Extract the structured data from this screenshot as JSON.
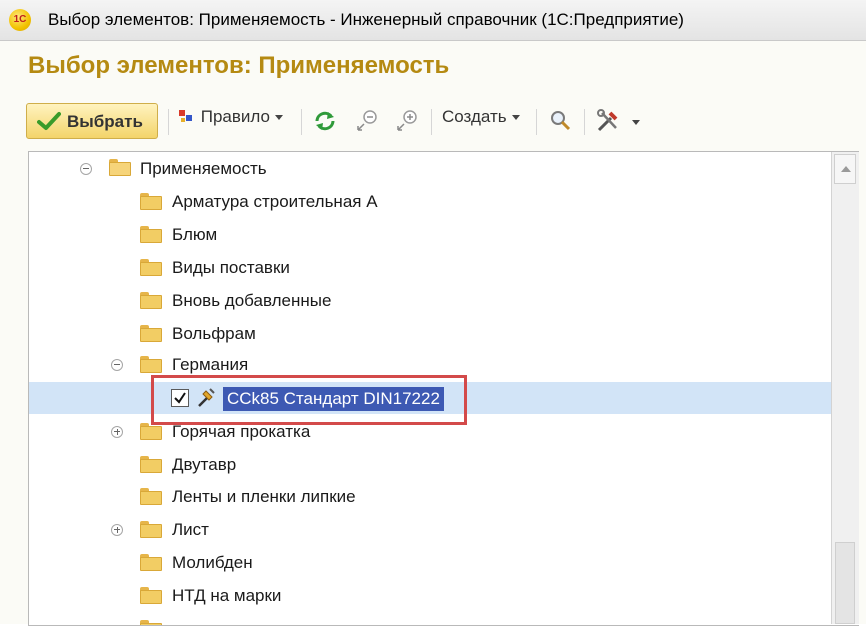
{
  "window": {
    "title": "Выбор элементов: Применяемость - Инженерный справочник  (1С:Предприятие)",
    "logo_text": "1С"
  },
  "form": {
    "title": "Выбор элементов: Применяемость"
  },
  "toolbar": {
    "select_label": "Выбрать",
    "rule_label": "Правило",
    "create_label": "Создать"
  },
  "tree": {
    "root_label": "Применяемость",
    "items": [
      {
        "label": "Арматура строительная А"
      },
      {
        "label": "Блюм"
      },
      {
        "label": "Виды поставки"
      },
      {
        "label": "Вновь добавленные"
      },
      {
        "label": "Вольфрам"
      },
      {
        "label": "Германия"
      },
      {
        "label": "Горячая прокатка"
      },
      {
        "label": "Двутавр"
      },
      {
        "label": "Ленты и пленки липкие"
      },
      {
        "label": "Лист"
      },
      {
        "label": "Молибден"
      },
      {
        "label": "НТД на марки"
      }
    ],
    "selected_item": {
      "label": "СCk85 Стандарт DIN17222",
      "checked": true
    }
  },
  "colors": {
    "accent": "#b58a12",
    "selection": "#3d59b3",
    "highlight_box": "#d34a4a"
  }
}
